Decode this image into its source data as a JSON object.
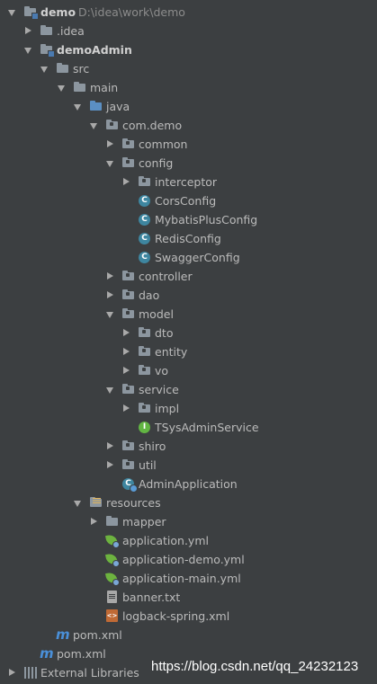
{
  "tree": [
    {
      "label": "demo",
      "bold": true,
      "path": "D:\\idea\\work\\demo",
      "expanded": true,
      "icon": "module-folder-icon"
    },
    {
      "label": ".idea",
      "expanded": false,
      "icon": "folder-icon"
    },
    {
      "label": "demoAdmin",
      "bold": true,
      "expanded": true,
      "icon": "module-folder-icon"
    },
    {
      "label": "src",
      "expanded": true,
      "icon": "folder-icon"
    },
    {
      "label": "main",
      "expanded": true,
      "icon": "folder-icon"
    },
    {
      "label": "java",
      "expanded": true,
      "icon": "source-folder-icon"
    },
    {
      "label": "com.demo",
      "expanded": true,
      "icon": "package-icon"
    },
    {
      "label": "common",
      "expanded": false,
      "icon": "package-icon"
    },
    {
      "label": "config",
      "expanded": true,
      "icon": "package-icon"
    },
    {
      "label": "interceptor",
      "expanded": false,
      "icon": "package-icon"
    },
    {
      "label": "CorsConfig",
      "icon": "class-icon"
    },
    {
      "label": "MybatisPlusConfig",
      "icon": "class-icon"
    },
    {
      "label": "RedisConfig",
      "icon": "class-icon"
    },
    {
      "label": "SwaggerConfig",
      "icon": "class-icon"
    },
    {
      "label": "controller",
      "expanded": false,
      "icon": "package-icon"
    },
    {
      "label": "dao",
      "expanded": false,
      "icon": "package-icon"
    },
    {
      "label": "model",
      "expanded": true,
      "icon": "package-icon"
    },
    {
      "label": "dto",
      "expanded": false,
      "icon": "package-icon"
    },
    {
      "label": "entity",
      "expanded": false,
      "icon": "package-icon"
    },
    {
      "label": "vo",
      "expanded": false,
      "icon": "package-icon"
    },
    {
      "label": "service",
      "expanded": true,
      "icon": "package-icon"
    },
    {
      "label": "impl",
      "expanded": false,
      "icon": "package-icon"
    },
    {
      "label": "TSysAdminService",
      "icon": "interface-icon"
    },
    {
      "label": "shiro",
      "expanded": false,
      "icon": "package-icon"
    },
    {
      "label": "util",
      "expanded": false,
      "icon": "package-icon"
    },
    {
      "label": "AdminApplication",
      "icon": "spring-boot-class-icon"
    },
    {
      "label": "resources",
      "expanded": true,
      "icon": "resources-folder-icon"
    },
    {
      "label": "mapper",
      "expanded": false,
      "icon": "folder-icon"
    },
    {
      "label": "application.yml",
      "icon": "spring-yml-icon"
    },
    {
      "label": "application-demo.yml",
      "icon": "spring-yml-icon"
    },
    {
      "label": "application-main.yml",
      "icon": "spring-yml-icon"
    },
    {
      "label": "banner.txt",
      "icon": "text-file-icon"
    },
    {
      "label": "logback-spring.xml",
      "icon": "xml-file-icon"
    },
    {
      "label": "pom.xml",
      "icon": "maven-icon"
    },
    {
      "label": "pom.xml",
      "icon": "maven-icon"
    },
    {
      "label": "External Libraries",
      "expanded": false,
      "icon": "libraries-icon"
    }
  ],
  "watermark": "https://blog.csdn.net/qq_24232123"
}
